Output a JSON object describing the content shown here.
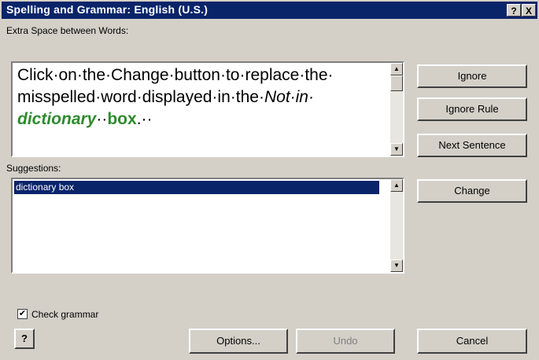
{
  "window": {
    "title": "Spelling and Grammar: English (U.S.)",
    "help_button": "?",
    "close_button": "X"
  },
  "issue_label": "Extra Space between Words:",
  "sentence": {
    "line1": "Click·on·the·Change·button·to·replace·the·",
    "line2_a": "misspelled·word·displayed·in·the·",
    "line2_b": "Not·in·",
    "line3_a": "dictionary",
    "line3_b": "··",
    "line3_c": "box",
    "line3_d": ".··"
  },
  "suggestions_label": "Suggestions:",
  "suggestions": [
    "dictionary box"
  ],
  "buttons": {
    "ignore": "Ignore",
    "ignore_rule": "Ignore Rule",
    "next_sentence": "Next Sentence",
    "change": "Change",
    "options": "Options...",
    "undo": "Undo",
    "cancel": "Cancel"
  },
  "check_grammar": {
    "label": "Check grammar",
    "checked": true
  }
}
